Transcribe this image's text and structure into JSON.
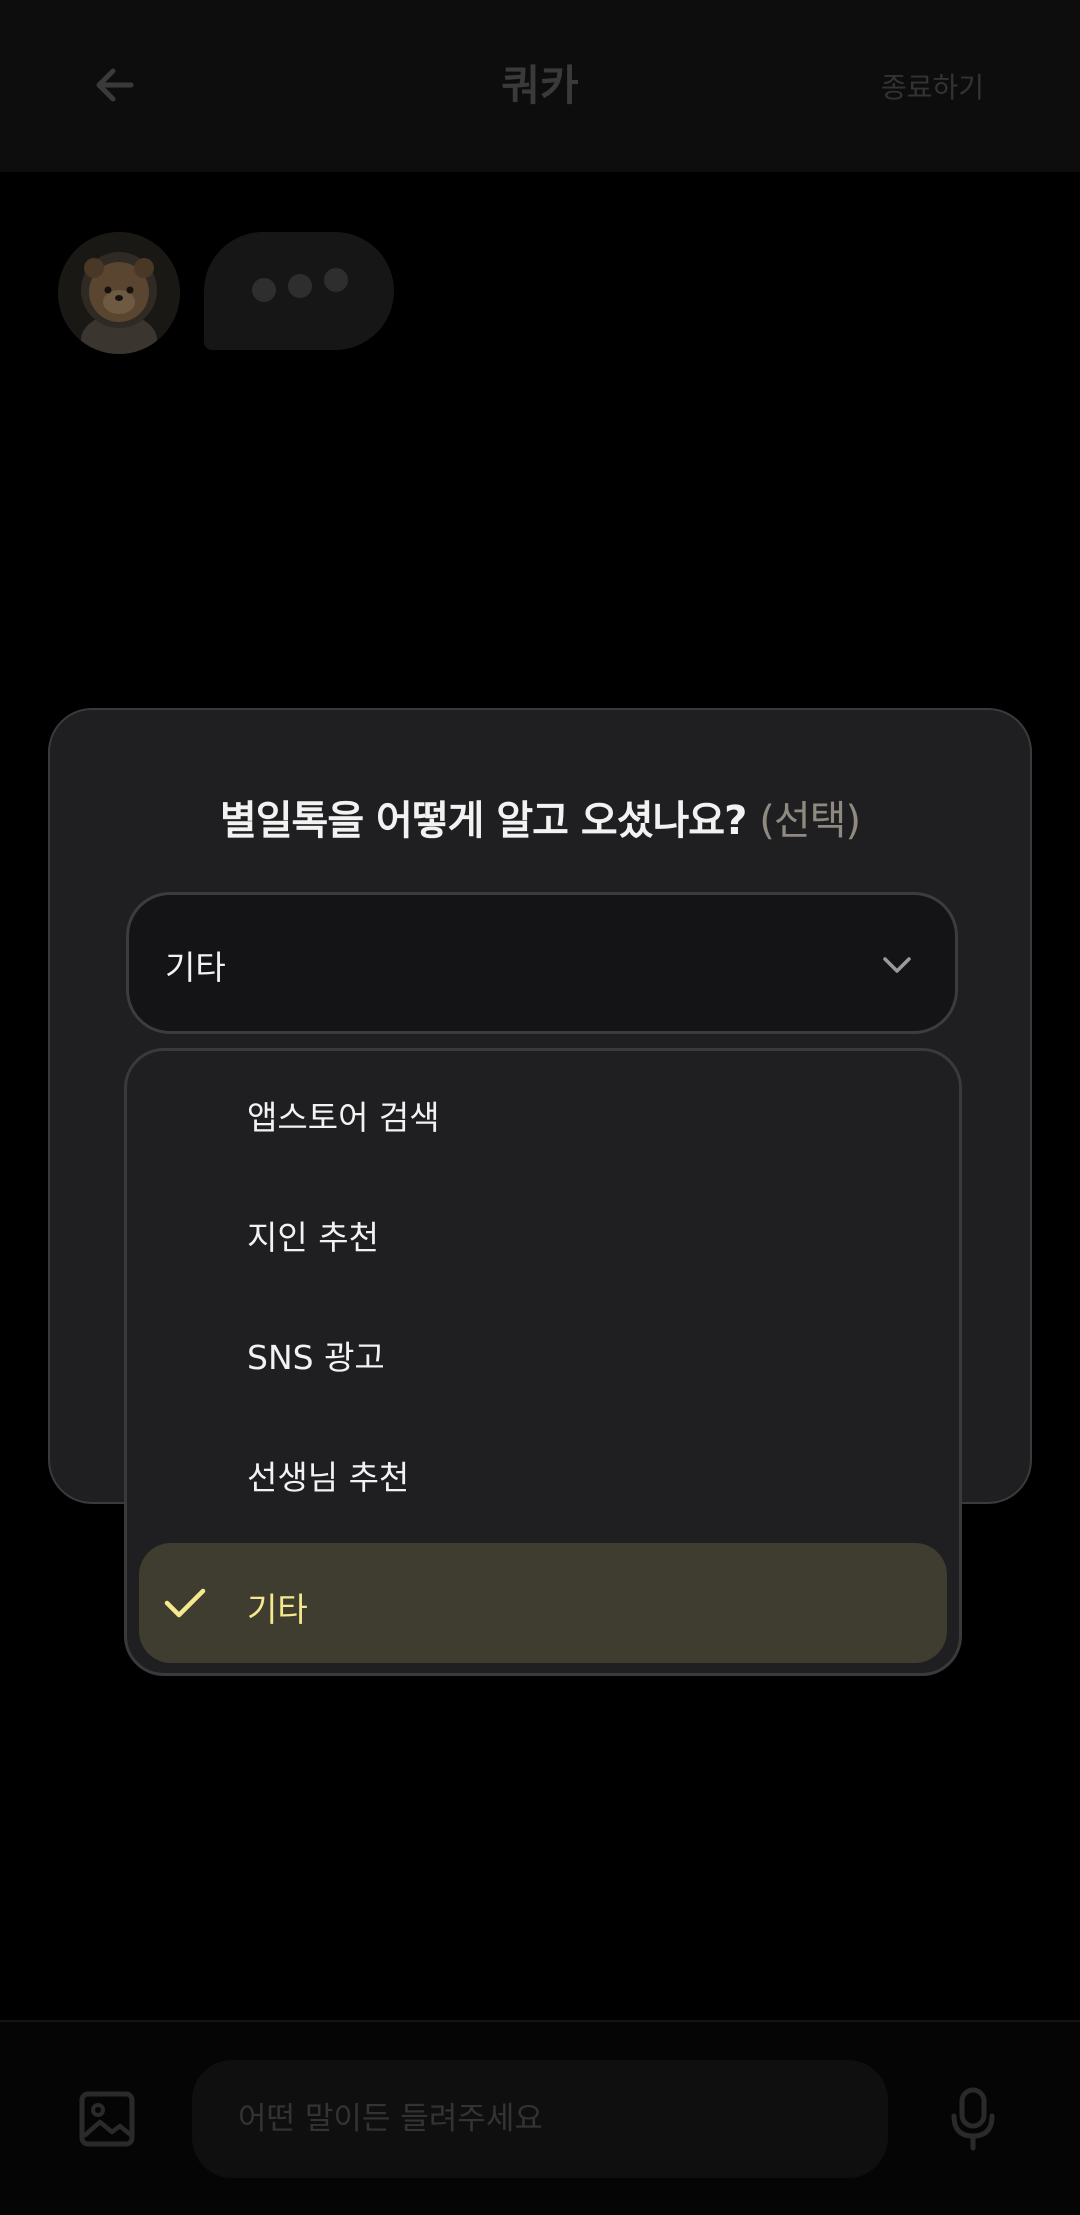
{
  "header": {
    "title": "쿼카",
    "end_label": "종료하기"
  },
  "chat": {
    "typing_indicator": "•••"
  },
  "survey": {
    "question": "별일톡을 어떻게 알고 오셨나요?",
    "optional_tag": "(선택)",
    "selected_value": "기타",
    "options": [
      {
        "label": "앱스토어 검색",
        "selected": false
      },
      {
        "label": "지인 추천",
        "selected": false
      },
      {
        "label": "SNS 광고",
        "selected": false
      },
      {
        "label": "선생님 추천",
        "selected": false
      },
      {
        "label": "기타",
        "selected": true
      }
    ]
  },
  "composer": {
    "placeholder": "어떤 말이든 들려주세요"
  },
  "colors": {
    "accent": "#f5e98f",
    "selected_bg": "#3e3d30",
    "card_bg": "#1f1f21"
  },
  "icons": {
    "back": "arrow-left-icon",
    "chevron": "chevron-down-icon",
    "check": "check-icon",
    "image": "image-icon",
    "mic": "microphone-icon",
    "avatar": "quokka-astronaut-avatar"
  }
}
